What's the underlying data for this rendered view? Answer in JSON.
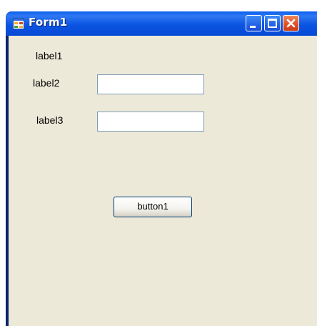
{
  "window": {
    "title": "Form1",
    "icon": "form-app-icon",
    "controls": {
      "minimize_icon": "minimize-icon",
      "maximize_icon": "maximize-icon",
      "close_icon": "close-icon"
    },
    "colors": {
      "titlebar": "#0b55e3",
      "client_background": "#ece9d8",
      "close_button": "#e0512a"
    }
  },
  "form": {
    "label1": "label1",
    "label2": "label2",
    "label3": "label3",
    "textbox1": {
      "value": "",
      "placeholder": ""
    },
    "textbox2": {
      "value": "",
      "placeholder": ""
    },
    "button1": "button1"
  }
}
